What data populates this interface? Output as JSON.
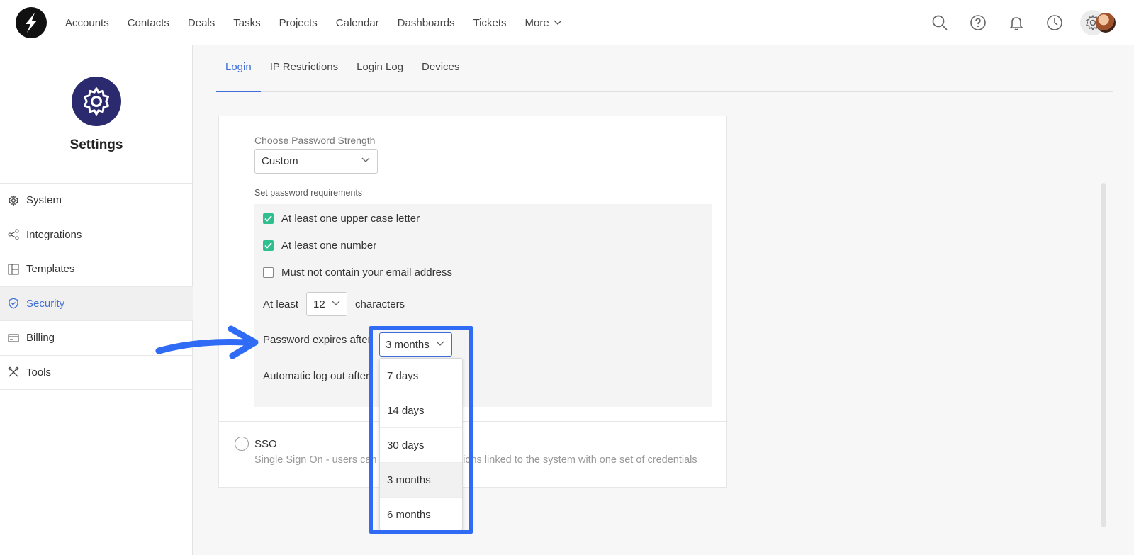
{
  "nav": {
    "items": [
      "Accounts",
      "Contacts",
      "Deals",
      "Tasks",
      "Projects",
      "Calendar",
      "Dashboards",
      "Tickets"
    ],
    "more": "More"
  },
  "top_icons": [
    "search-icon",
    "help-icon",
    "bell-icon",
    "clock-icon",
    "gear-icon"
  ],
  "sidebar": {
    "title": "Settings",
    "items": [
      {
        "label": "System",
        "icon": "gear-icon"
      },
      {
        "label": "Integrations",
        "icon": "share-icon"
      },
      {
        "label": "Templates",
        "icon": "layout-icon"
      },
      {
        "label": "Security",
        "icon": "shield-icon",
        "active": true
      },
      {
        "label": "Billing",
        "icon": "card-icon"
      },
      {
        "label": "Tools",
        "icon": "tools-icon"
      }
    ]
  },
  "tabs": [
    "Login",
    "IP Restrictions",
    "Login Log",
    "Devices"
  ],
  "password": {
    "strength_label": "Choose Password Strength",
    "strength_value": "Custom",
    "requirements_label": "Set password requirements",
    "checks": [
      {
        "label": "At least one upper case letter",
        "checked": true
      },
      {
        "label": "At least one number",
        "checked": true
      },
      {
        "label": "Must not contain your email address",
        "checked": false
      }
    ],
    "min_prefix": "At least",
    "min_value": "12",
    "min_suffix": "characters",
    "expires_label": "Password expires after",
    "expires_value": "3 months",
    "logout_label": "Automatic log out after"
  },
  "expires_options": [
    "7 days",
    "14 days",
    "30 days",
    "3 months",
    "6 months"
  ],
  "selected_option": "3 months",
  "sso": {
    "title": "SSO",
    "description": "Single Sign On - users can access all applications linked to the system with one set of credentials"
  },
  "colors": {
    "accent": "#3f6fd6",
    "check": "#2fbf8e",
    "highlight": "#2f6bf5",
    "badge": "#2b2a6e"
  }
}
